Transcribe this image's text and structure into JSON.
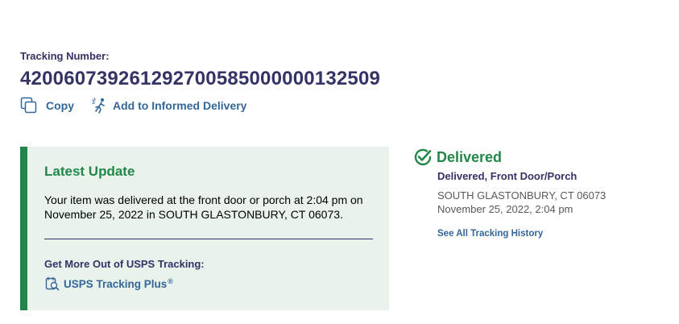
{
  "tracking": {
    "label": "Tracking Number:",
    "number": "420060739261292700585000000132509"
  },
  "actions": {
    "copy_label": "Copy",
    "informed_label": "Add to Informed Delivery"
  },
  "latest_update": {
    "title": "Latest Update",
    "text": "Your item was delivered at the front door or porch at 2:04 pm on November 25, 2022 in SOUTH GLASTONBURY, CT 06073.",
    "more_title": "Get More Out of USPS Tracking:",
    "plus_label": "USPS Tracking Plus",
    "plus_mark": "®"
  },
  "status": {
    "word": "Delivered",
    "detail": "Delivered, Front Door/Porch",
    "location": "SOUTH GLASTONBURY, CT 06073",
    "datetime": "November 25, 2022, 2:04 pm",
    "history_link": "See All Tracking History"
  },
  "colors": {
    "navy": "#333366",
    "green": "#218748",
    "link_blue": "#336699",
    "panel_bg": "#eaf2ec"
  },
  "icons": {
    "copy": "copy-icon",
    "informed": "informed-delivery-icon",
    "plus": "tracking-plus-icon",
    "delivered": "check-circle-icon"
  }
}
